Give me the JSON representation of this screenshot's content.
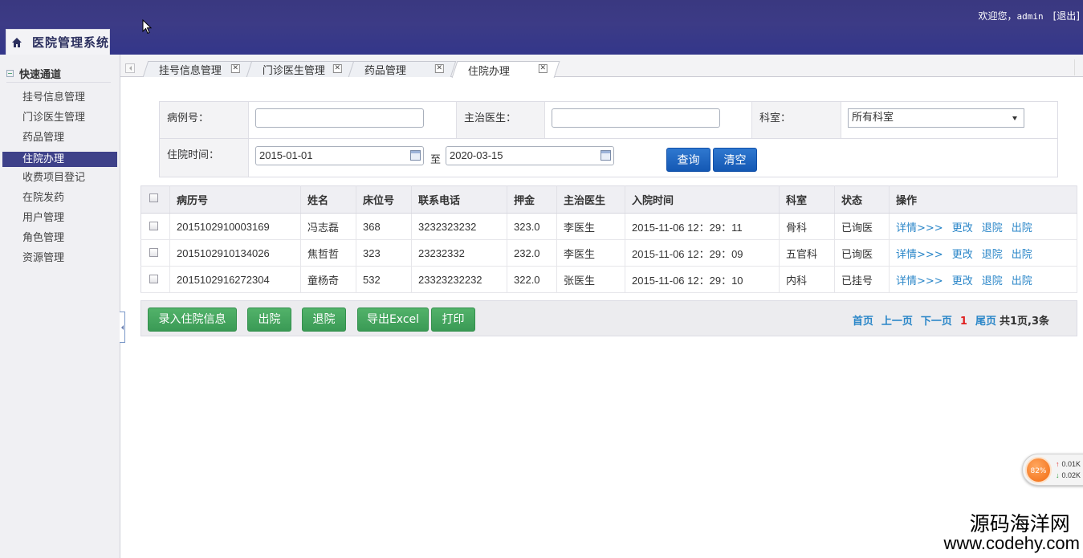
{
  "header": {
    "welcome": "欢迎您，",
    "user": "admin",
    "logout": "[退出]",
    "app_title": "医院管理系统"
  },
  "sidebar": {
    "section_title": "快速通道",
    "items": [
      {
        "label": "挂号信息管理",
        "active": false
      },
      {
        "label": "门诊医生管理",
        "active": false
      },
      {
        "label": "药品管理",
        "active": false
      },
      {
        "label": "住院办理",
        "active": true
      },
      {
        "label": "收费项目登记",
        "active": false
      },
      {
        "label": "在院发药",
        "active": false
      },
      {
        "label": "用户管理",
        "active": false
      },
      {
        "label": "角色管理",
        "active": false
      },
      {
        "label": "资源管理",
        "active": false
      }
    ]
  },
  "tabs": [
    {
      "label": "挂号信息管理",
      "active": false
    },
    {
      "label": "门诊医生管理",
      "active": false
    },
    {
      "label": "药品管理",
      "active": false
    },
    {
      "label": "住院办理",
      "active": true
    }
  ],
  "filter": {
    "case_no_label": "病例号：",
    "case_no_value": "",
    "doctor_label": "主治医生：",
    "doctor_value": "",
    "dept_label": "科室：",
    "dept_value": "所有科室",
    "time_label": "住院时间：",
    "date_from": "2015-01-01",
    "to_label": "至",
    "date_to": "2020-03-15",
    "search_button": "查询",
    "clear_button": "清空"
  },
  "table": {
    "headers": [
      "病历号",
      "姓名",
      "床位号",
      "联系电话",
      "押金",
      "主治医生",
      "入院时间",
      "科室",
      "状态",
      "操作"
    ],
    "rows": [
      {
        "case_no": "2015102910003169",
        "name": "冯志磊",
        "bed": "368",
        "phone": "3232323232",
        "deposit": "323.0",
        "doctor": "李医生",
        "admit_time": "2015-11-06 12：29：11",
        "dept": "骨科",
        "status": "已询医"
      },
      {
        "case_no": "2015102910134026",
        "name": "焦哲哲",
        "bed": "323",
        "phone": "23232332",
        "deposit": "232.0",
        "doctor": "李医生",
        "admit_time": "2015-11-06 12：29：09",
        "dept": "五官科",
        "status": "已询医"
      },
      {
        "case_no": "2015102916272304",
        "name": "童杨奇",
        "bed": "532",
        "phone": "23323232232",
        "deposit": "322.0",
        "doctor": "张医生",
        "admit_time": "2015-11-06 12：29：10",
        "dept": "内科",
        "status": "已挂号"
      }
    ],
    "row_actions": [
      "详情>>>",
      "更改",
      "退院",
      "出院"
    ]
  },
  "actions": {
    "add": "录入住院信息",
    "discharge": "出院",
    "withdraw": "退院",
    "export": "导出Excel",
    "print": "打印"
  },
  "pager": {
    "first": "首页",
    "prev": "上一页",
    "next": "下一页",
    "current": "1",
    "last": "尾页",
    "summary": "共1页,3条"
  },
  "speed_widget": {
    "percent": "82%",
    "up": "0.01K",
    "down": "0.02K"
  },
  "watermark": {
    "cn": "源码海洋网",
    "url": "www.codehy.com"
  },
  "colors": {
    "header_bg": "#3a3880",
    "sidebar_active": "#3e4189",
    "link": "#2a86c8",
    "primary_button": "#1c64c0",
    "success_button": "#45a660",
    "pager_current": "#e02020"
  }
}
